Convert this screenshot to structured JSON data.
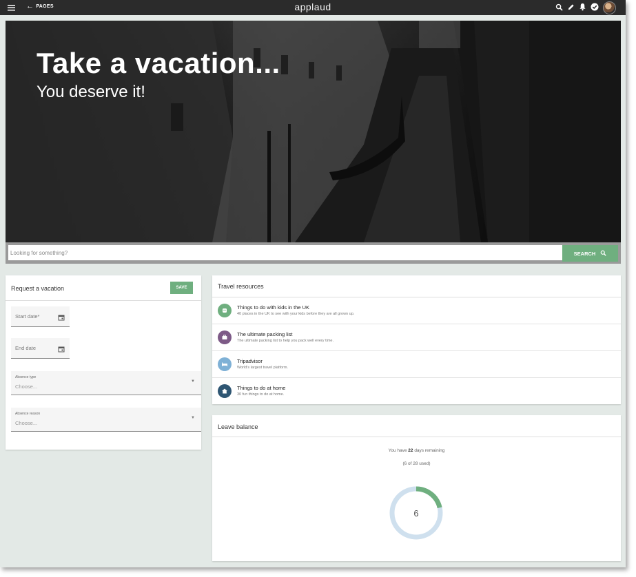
{
  "topbar": {
    "back_label": "PAGES",
    "brand": "applaud",
    "icons": [
      "menu-icon",
      "arrow-left-icon",
      "search-icon",
      "pencil-icon",
      "bell-icon",
      "check-circle-icon",
      "avatar"
    ]
  },
  "hero": {
    "title": "Take a vacation...",
    "subtitle": "You deserve it!"
  },
  "search": {
    "placeholder": "Looking for something?",
    "button_label": "SEARCH"
  },
  "request": {
    "title": "Request a vacation",
    "save_label": "SAVE",
    "start_date_label": "Start date*",
    "end_date_label": "End date",
    "absence_type_label": "Absence type",
    "absence_type_value": "Choose...",
    "absence_reason_label": "Absence reason",
    "absence_reason_value": "Choose..."
  },
  "travel": {
    "title": "Travel resources",
    "items": [
      {
        "title": "Things to do with kids in the UK",
        "desc": "40 places in the UK to see with your kids before they are all grown up.",
        "icon": "kids-icon",
        "color": "#6faf7f"
      },
      {
        "title": "The ultimate packing list",
        "desc": "The ultimate packing list to help you pack well every time.",
        "icon": "suitcase-icon",
        "color": "#7d5a87"
      },
      {
        "title": "Tripadvisor",
        "desc": "World's largest travel platform.",
        "icon": "bed-icon",
        "color": "#7fb1d6"
      },
      {
        "title": "Things to do at home",
        "desc": "30 fun things to do at home.",
        "icon": "home-icon",
        "color": "#2f5673"
      }
    ]
  },
  "leave": {
    "title": "Leave balance",
    "line1_prefix": "You have ",
    "days_remaining": "22",
    "line1_suffix": " days remaining",
    "line2": "(6 of 28 used)",
    "used": 6,
    "total": 28,
    "donut_label": "6",
    "colors": {
      "used": "#6faf7f",
      "remaining": "#cfe0ee"
    }
  },
  "colors": {
    "accent": "#6faf7f",
    "topbar": "#2b2b2b",
    "background": "#e3e9e6"
  }
}
